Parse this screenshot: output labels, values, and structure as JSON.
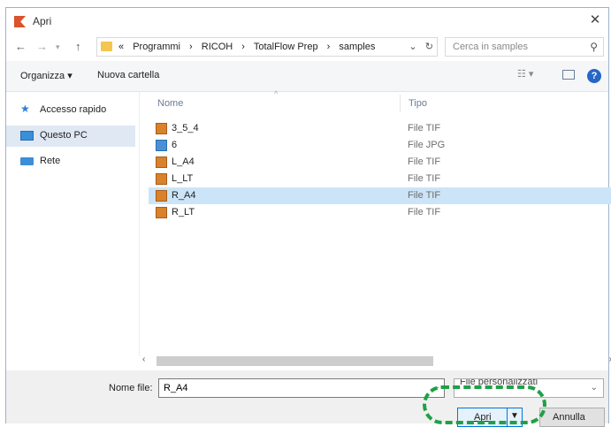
{
  "window": {
    "title": "Apri"
  },
  "nav": {
    "crumbs_prefix": "«",
    "crumbs": [
      "Programmi",
      "RICOH",
      "TotalFlow Prep",
      "samples"
    ],
    "separator": "›",
    "search_placeholder": "Cerca in samples"
  },
  "toolbar": {
    "organize": "Organizza ▾",
    "new_folder": "Nuova cartella"
  },
  "sidebar": {
    "items": [
      {
        "label": "Accesso rapido",
        "icon": "star-icon",
        "selected": false
      },
      {
        "label": "Questo PC",
        "icon": "computer-icon",
        "selected": true
      },
      {
        "label": "Rete",
        "icon": "network-icon",
        "selected": false
      }
    ]
  },
  "list": {
    "columns": {
      "name": "Nome",
      "type": "Tipo"
    },
    "rows": [
      {
        "name": "3_5_4",
        "type": "File TIF",
        "icon": "tif-file-icon",
        "selected": false
      },
      {
        "name": "6",
        "type": "File JPG",
        "icon": "jpg-file-icon",
        "selected": false
      },
      {
        "name": "L_A4",
        "type": "File TIF",
        "icon": "tif-file-icon",
        "selected": false
      },
      {
        "name": "L_LT",
        "type": "File TIF",
        "icon": "tif-file-icon",
        "selected": false
      },
      {
        "name": "R_A4",
        "type": "File TIF",
        "icon": "tif-file-icon",
        "selected": true
      },
      {
        "name": "R_LT",
        "type": "File TIF",
        "icon": "tif-file-icon",
        "selected": false
      }
    ]
  },
  "footer": {
    "filename_label": "Nome file:",
    "filename_value": "R_A4",
    "filter_label": "File personalizzati",
    "open_button": "Apri",
    "cancel_button": "Annulla"
  },
  "colors": {
    "accent": "#0078d7",
    "selection": "#cce4f7",
    "highlight": "#1fa045"
  }
}
